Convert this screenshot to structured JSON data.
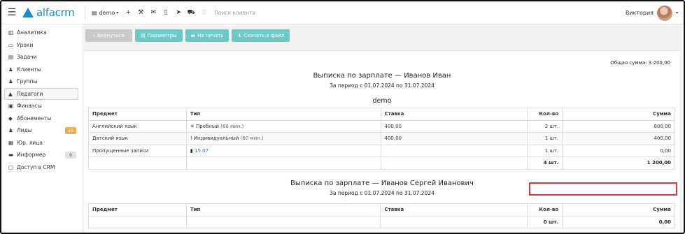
{
  "header": {
    "logo_text": "alfacrm",
    "branch": "demo",
    "search_placeholder": "Поиск клиента",
    "user_name": "Виктория"
  },
  "sidebar": {
    "items": [
      {
        "icon": "▥",
        "icon_name": "chart-icon",
        "label": "Аналитика"
      },
      {
        "icon": "▭",
        "icon_name": "calendar-icon",
        "label": "Уроки"
      },
      {
        "icon": "▤",
        "icon_name": "tasks-icon",
        "label": "Задачи"
      },
      {
        "icon": "♟",
        "icon_name": "user-icon",
        "label": "Клиенты"
      },
      {
        "icon": "♟",
        "icon_name": "users-icon",
        "label": "Группы"
      },
      {
        "icon": "▲",
        "icon_name": "graduation-cap-icon",
        "label": "Педагоги"
      },
      {
        "icon": "▣",
        "icon_name": "money-icon",
        "label": "Финансы"
      },
      {
        "icon": "◆",
        "icon_name": "tag-icon",
        "label": "Абонементы"
      },
      {
        "icon": "♟",
        "icon_name": "user-plus-icon",
        "label": "Лиды",
        "badge": "15"
      },
      {
        "icon": "▦",
        "icon_name": "building-icon",
        "label": "Юр. лица"
      },
      {
        "icon": "▬",
        "icon_name": "briefcase-icon",
        "label": "Информер",
        "badge": "9"
      },
      {
        "icon": "▢",
        "icon_name": "lock-icon",
        "label": "Доступ в CRM"
      }
    ]
  },
  "toolbar": {
    "back_label": "Вернуться",
    "params_label": "Параметры",
    "print_label": "На печать",
    "download_label": "Скачать в файл"
  },
  "report": {
    "total_label": "Общая сумма: 3 200,00",
    "first": {
      "title": "Выписка по зарплате — Иванов Иван",
      "period": "За период с 01.07.2024 по 31.07.2024",
      "branch": "demo",
      "columns": [
        "Предмет",
        "Тип",
        "Ставка",
        "Кол-во",
        "Сумма"
      ],
      "rows": [
        {
          "subject": "Английский язык",
          "type_icon": "✳",
          "type": "Пробный",
          "type_note": "(60 мин.)",
          "rate": "400,00",
          "qty": "2 шт.",
          "sum": "800,00"
        },
        {
          "subject": "Датский язык",
          "type_icon": "!",
          "type": "Индивидуальный",
          "type_note": "(60 мин.)",
          "rate": "400,00",
          "qty": "1 шт.",
          "sum": "400,00"
        },
        {
          "subject": "Пропущенные записи",
          "type_icon": "▮",
          "type": "15.07",
          "type_note": "",
          "rate": "",
          "qty": "1 шт.",
          "sum": "0,00"
        }
      ],
      "total_qty": "4 шт.",
      "total_sum": "1 200,00"
    },
    "second": {
      "title": "Выписка по зарплате — Иванов Сергей Иванович",
      "period": "За период с 01.07.2024 по 31.07.2024",
      "columns": [
        "Предмет",
        "Тип",
        "Ставка",
        "Кол-во",
        "Сумма"
      ],
      "total_qty": "0 шт.",
      "total_sum": "0,00"
    }
  }
}
